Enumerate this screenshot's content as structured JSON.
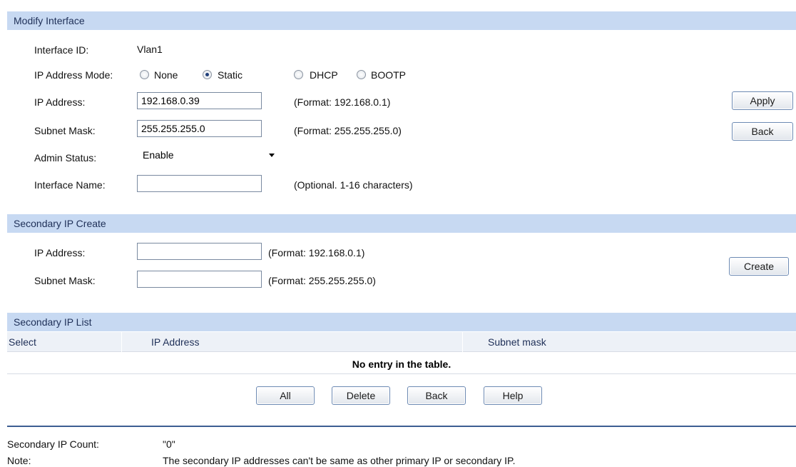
{
  "modify_interface": {
    "header": "Modify Interface",
    "interface_id_label": "Interface ID:",
    "interface_id_value": "Vlan1",
    "ip_mode_label": "IP Address Mode:",
    "ip_mode_options": [
      "None",
      "Static",
      "DHCP",
      "BOOTP"
    ],
    "ip_mode_selected": "Static",
    "ip_address_label": "IP Address:",
    "ip_address_value": "192.168.0.39",
    "ip_address_hint": "(Format: 192.168.0.1)",
    "subnet_label": "Subnet Mask:",
    "subnet_value": "255.255.255.0",
    "subnet_hint": "(Format: 255.255.255.0)",
    "admin_status_label": "Admin Status:",
    "admin_status_value": "Enable",
    "interface_name_label": "Interface Name:",
    "interface_name_value": "",
    "interface_name_hint": "(Optional. 1-16 characters)",
    "apply_label": "Apply",
    "back_label": "Back"
  },
  "secondary_create": {
    "header": "Secondary IP Create",
    "ip_address_label": "IP Address:",
    "ip_address_value": "",
    "ip_address_hint": "(Format: 192.168.0.1)",
    "subnet_label": "Subnet Mask:",
    "subnet_value": "",
    "subnet_hint": "(Format: 255.255.255.0)",
    "create_label": "Create"
  },
  "secondary_list": {
    "header": "Secondary IP List",
    "columns": [
      "Select",
      "IP Address",
      "Subnet mask"
    ],
    "empty_message": "No entry in the table.",
    "buttons": [
      "All",
      "Delete",
      "Back",
      "Help"
    ]
  },
  "footer": {
    "count_label": "Secondary IP Count:",
    "count_value": "\"0\"",
    "note_label": "Note:",
    "note_value": "The secondary IP addresses can't be same as other primary IP or secondary IP."
  },
  "colors": {
    "section_header_bg": "#c7d9f2",
    "table_header_bg": "#edf1f7",
    "divider": "#3d5e92"
  }
}
